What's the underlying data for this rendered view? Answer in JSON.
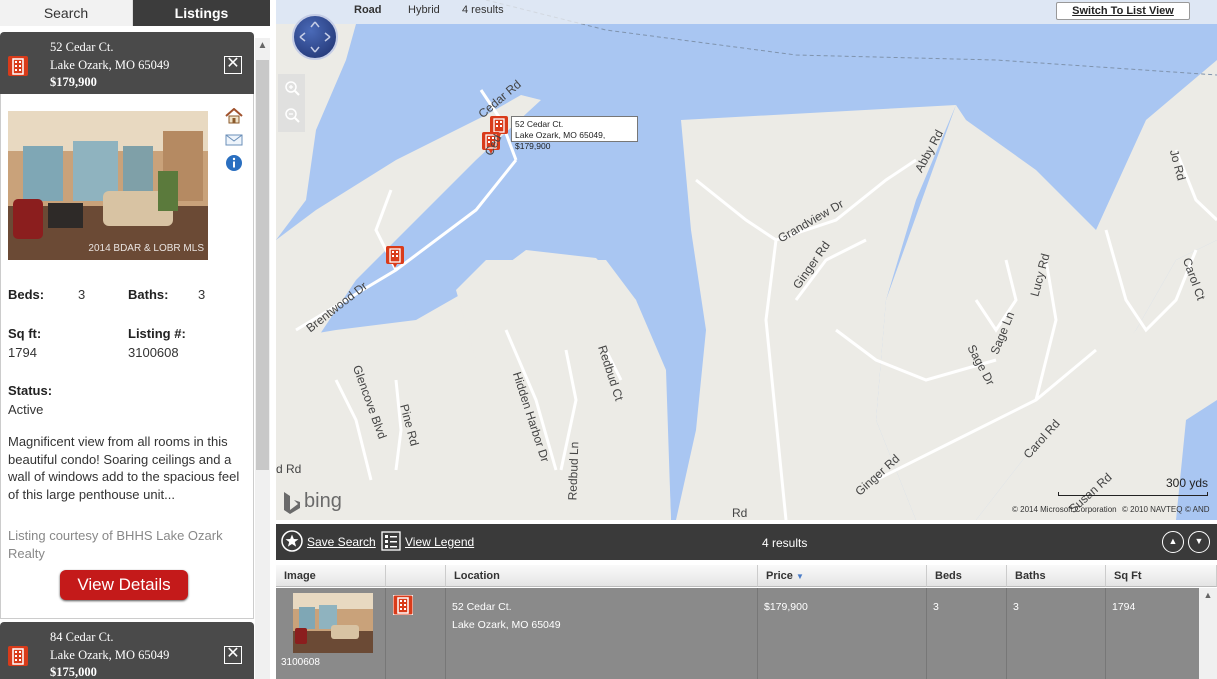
{
  "tabs": {
    "search": "Search",
    "listings": "Listings"
  },
  "listings": [
    {
      "address_line1": "52 Cedar Ct.",
      "address_line2": "Lake Ozark, MO 65049",
      "price": "$179,900",
      "photo_caption": "2014 BDAR & LOBR MLS",
      "beds_label": "Beds:",
      "beds": "3",
      "baths_label": "Baths:",
      "baths": "3",
      "sqft_label": "Sq ft:",
      "sqft": "1794",
      "listing_label": "Listing #:",
      "listing_no": "3100608",
      "status_label": "Status:",
      "status": "Active",
      "description": "Magnificent view from all rooms in this beautiful condo! Soaring ceilings and a wall of windows add to the spacious feel of this large penthouse unit...",
      "courtesy": "Listing courtesy of BHHS Lake Ozark Realty",
      "details_button": "View Details"
    },
    {
      "address_line1": "84 Cedar Ct.",
      "address_line2": "Lake Ozark, MO 65049",
      "price": "$175,000"
    }
  ],
  "map": {
    "road_tab": "Road",
    "hybrid_tab": "Hybrid",
    "results": "4 results",
    "switch_button": "Switch To List View",
    "tooltip_line1": "52 Cedar Ct.",
    "tooltip_line2": "Lake Ozark, MO 65049, $179,900",
    "bing": "bing",
    "scale": "300 yds",
    "copyright": [
      "© 2014 Microsoft Corporation",
      "© 2010 NAVTEQ",
      "© AND"
    ],
    "street_labels": {
      "cedar_rd": "Cedar Rd",
      "cedar_ct": "Ced",
      "brentwood": "Brentwood Dr",
      "glencove": "Glencove Blvd",
      "pine": "Pine Rd",
      "hidden_harbor": "Hidden Harbor Dr",
      "redbud_ln": "Redbud Ln",
      "redbud_ct": "Redbud Ct",
      "grandview": "Grandview Dr",
      "ginger_top": "Ginger Rd",
      "ginger_bottom": "Ginger Rd",
      "abby": "Abby Rd",
      "lucy": "Lucy Rd",
      "sage_ln": "Sage Ln",
      "sage_dr": "Sage Dr",
      "carol_rd": "Carol Rd",
      "carol_ct": "Carol Ct",
      "jo": "Jo Rd",
      "susan": "Susan Rd",
      "left_rd": "d Rd",
      "bottom_rd": "Rd"
    },
    "colors": {
      "water": "#a9c6f2",
      "land": "#ecebe6",
      "pin": "#d93b1a"
    }
  },
  "toolbar": {
    "save_search": "Save Search",
    "view_legend": "View Legend",
    "results": "4 results"
  },
  "table": {
    "headers": {
      "image": "Image",
      "location": "Location",
      "price": "Price",
      "beds": "Beds",
      "baths": "Baths",
      "sqft": "Sq Ft"
    },
    "rows": [
      {
        "listing_no": "3100608",
        "street": "52 Cedar Ct.",
        "city": "Lake Ozark, MO  65049",
        "price": "$179,900",
        "beds": "3",
        "baths": "3",
        "sqft": "1794"
      }
    ]
  }
}
